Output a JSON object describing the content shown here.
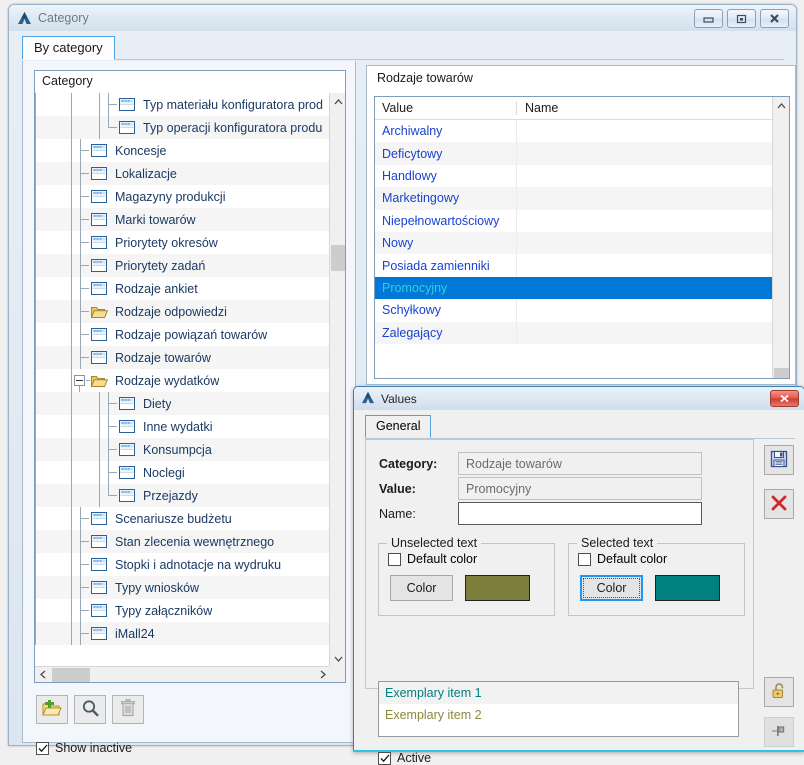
{
  "window": {
    "title": "Category",
    "logo_icon": "app-triangle-icon",
    "buttons": {
      "minimize": "minimize-icon",
      "restore": "restore-icon",
      "close": "close-icon"
    }
  },
  "tabs": [
    {
      "label": "By category",
      "selected": true
    }
  ],
  "tree": {
    "header": "Category",
    "items": [
      {
        "label": "Typ materiału konfiguratora prod",
        "icon": "table-icon",
        "depth": 3,
        "alt": false,
        "clipped": true
      },
      {
        "label": "Typ operacji konfiguratora produ",
        "icon": "table-icon",
        "depth": 3,
        "alt": true,
        "clipped": true
      },
      {
        "label": "Koncesje",
        "icon": "table-icon",
        "depth": 2,
        "alt": false
      },
      {
        "label": "Lokalizacje",
        "icon": "table-icon",
        "depth": 2,
        "alt": true
      },
      {
        "label": "Magazyny produkcji",
        "icon": "table-icon",
        "depth": 2,
        "alt": false
      },
      {
        "label": "Marki towarów",
        "icon": "table-icon",
        "depth": 2,
        "alt": true
      },
      {
        "label": "Priorytety okresów",
        "icon": "table-icon",
        "depth": 2,
        "alt": false
      },
      {
        "label": "Priorytety zadań",
        "icon": "table-icon",
        "depth": 2,
        "alt": true
      },
      {
        "label": "Rodzaje ankiet",
        "icon": "table-icon",
        "depth": 2,
        "alt": false
      },
      {
        "label": "Rodzaje odpowiedzi",
        "icon": "folder-icon",
        "depth": 2,
        "alt": true
      },
      {
        "label": "Rodzaje powiązań towarów",
        "icon": "table-icon",
        "depth": 2,
        "alt": false
      },
      {
        "label": "Rodzaje towarów",
        "icon": "table-icon",
        "depth": 2,
        "alt": true
      },
      {
        "label": "Rodzaje wydatków",
        "icon": "folder-icon",
        "depth": 2,
        "alt": false,
        "expanded": true
      },
      {
        "label": "Diety",
        "icon": "table-icon",
        "depth": 3,
        "alt": true
      },
      {
        "label": "Inne wydatki",
        "icon": "table-icon",
        "depth": 3,
        "alt": false
      },
      {
        "label": "Konsumpcja",
        "icon": "table-icon",
        "depth": 3,
        "alt": true
      },
      {
        "label": "Noclegi",
        "icon": "table-icon",
        "depth": 3,
        "alt": false
      },
      {
        "label": "Przejazdy",
        "icon": "table-icon",
        "depth": 3,
        "alt": true
      },
      {
        "label": "Scenariusze budżetu",
        "icon": "table-icon",
        "depth": 2,
        "alt": false
      },
      {
        "label": "Stan zlecenia wewnętrznego",
        "icon": "table-icon",
        "depth": 2,
        "alt": true
      },
      {
        "label": "Stopki i adnotacje na wydruku",
        "icon": "table-icon",
        "depth": 2,
        "alt": false
      },
      {
        "label": "Typy wniosków",
        "icon": "table-icon",
        "depth": 2,
        "alt": true
      },
      {
        "label": "Typy załączników",
        "icon": "table-icon",
        "depth": 2,
        "alt": false
      },
      {
        "label": "iMall24",
        "icon": "table-icon",
        "depth": 2,
        "alt": true
      }
    ]
  },
  "toolbar": {
    "add": {
      "label": "",
      "icon": "add-folder-icon"
    },
    "search": {
      "label": "",
      "icon": "magnifier-icon"
    },
    "delete": {
      "label": "",
      "icon": "trash-icon",
      "disabled": true
    },
    "show_inactive": {
      "label": "Show inactive",
      "checked": true
    }
  },
  "list_panel": {
    "title": "Rodzaje towarów",
    "columns": [
      "Value",
      "Name"
    ],
    "rows": [
      {
        "value": "Archiwalny",
        "name": "",
        "selected": false
      },
      {
        "value": "Deficytowy",
        "name": "",
        "selected": false
      },
      {
        "value": "Handlowy",
        "name": "",
        "selected": false
      },
      {
        "value": "Marketingowy",
        "name": "",
        "selected": false
      },
      {
        "value": "Niepełnowartościowy",
        "name": "",
        "selected": false
      },
      {
        "value": "Nowy",
        "name": "",
        "selected": false
      },
      {
        "value": "Posiada zamienniki",
        "name": "",
        "selected": false
      },
      {
        "value": "Promocyjny",
        "name": "",
        "selected": true
      },
      {
        "value": "Schyłkowy",
        "name": "",
        "selected": false
      },
      {
        "value": "Zalegający",
        "name": "",
        "selected": false
      }
    ],
    "selection_bg": "#0078d7",
    "selection_fg": "#29d4d4",
    "row_fg": "#1a43d0"
  },
  "dialog": {
    "title": "Values",
    "logo_icon": "app-triangle-icon",
    "close_icon": "close-icon",
    "tabs": [
      {
        "label": "General",
        "selected": true
      }
    ],
    "fields": {
      "category_label": "Category:",
      "category_value": "Rodzaje towarów",
      "value_label": "Value:",
      "value_value": "Promocyjny",
      "name_label": "Name:",
      "name_value": "",
      "name_placeholder": ""
    },
    "unselected_group": {
      "legend": "Unselected text",
      "default_color_label": "Default color",
      "default_color_checked": false,
      "color_button_label": "Color",
      "color_button_focused": false,
      "swatch_color": "#7d7d3c"
    },
    "selected_group": {
      "legend": "Selected text",
      "default_color_label": "Default color",
      "default_color_checked": false,
      "color_button_label": "Color",
      "color_button_focused": true,
      "swatch_color": "#00807f"
    },
    "preview": {
      "item1": "Exemplary item 1",
      "item1_color": "#00807f",
      "item2": "Exemplary item 2",
      "item2_color": "#8a8a3e"
    },
    "active": {
      "label": "Active",
      "checked": true
    },
    "buttons": {
      "save": "save-icon",
      "cancel": "cancel-icon",
      "unlock": "unlock-icon",
      "pin": "pin-icon"
    }
  }
}
